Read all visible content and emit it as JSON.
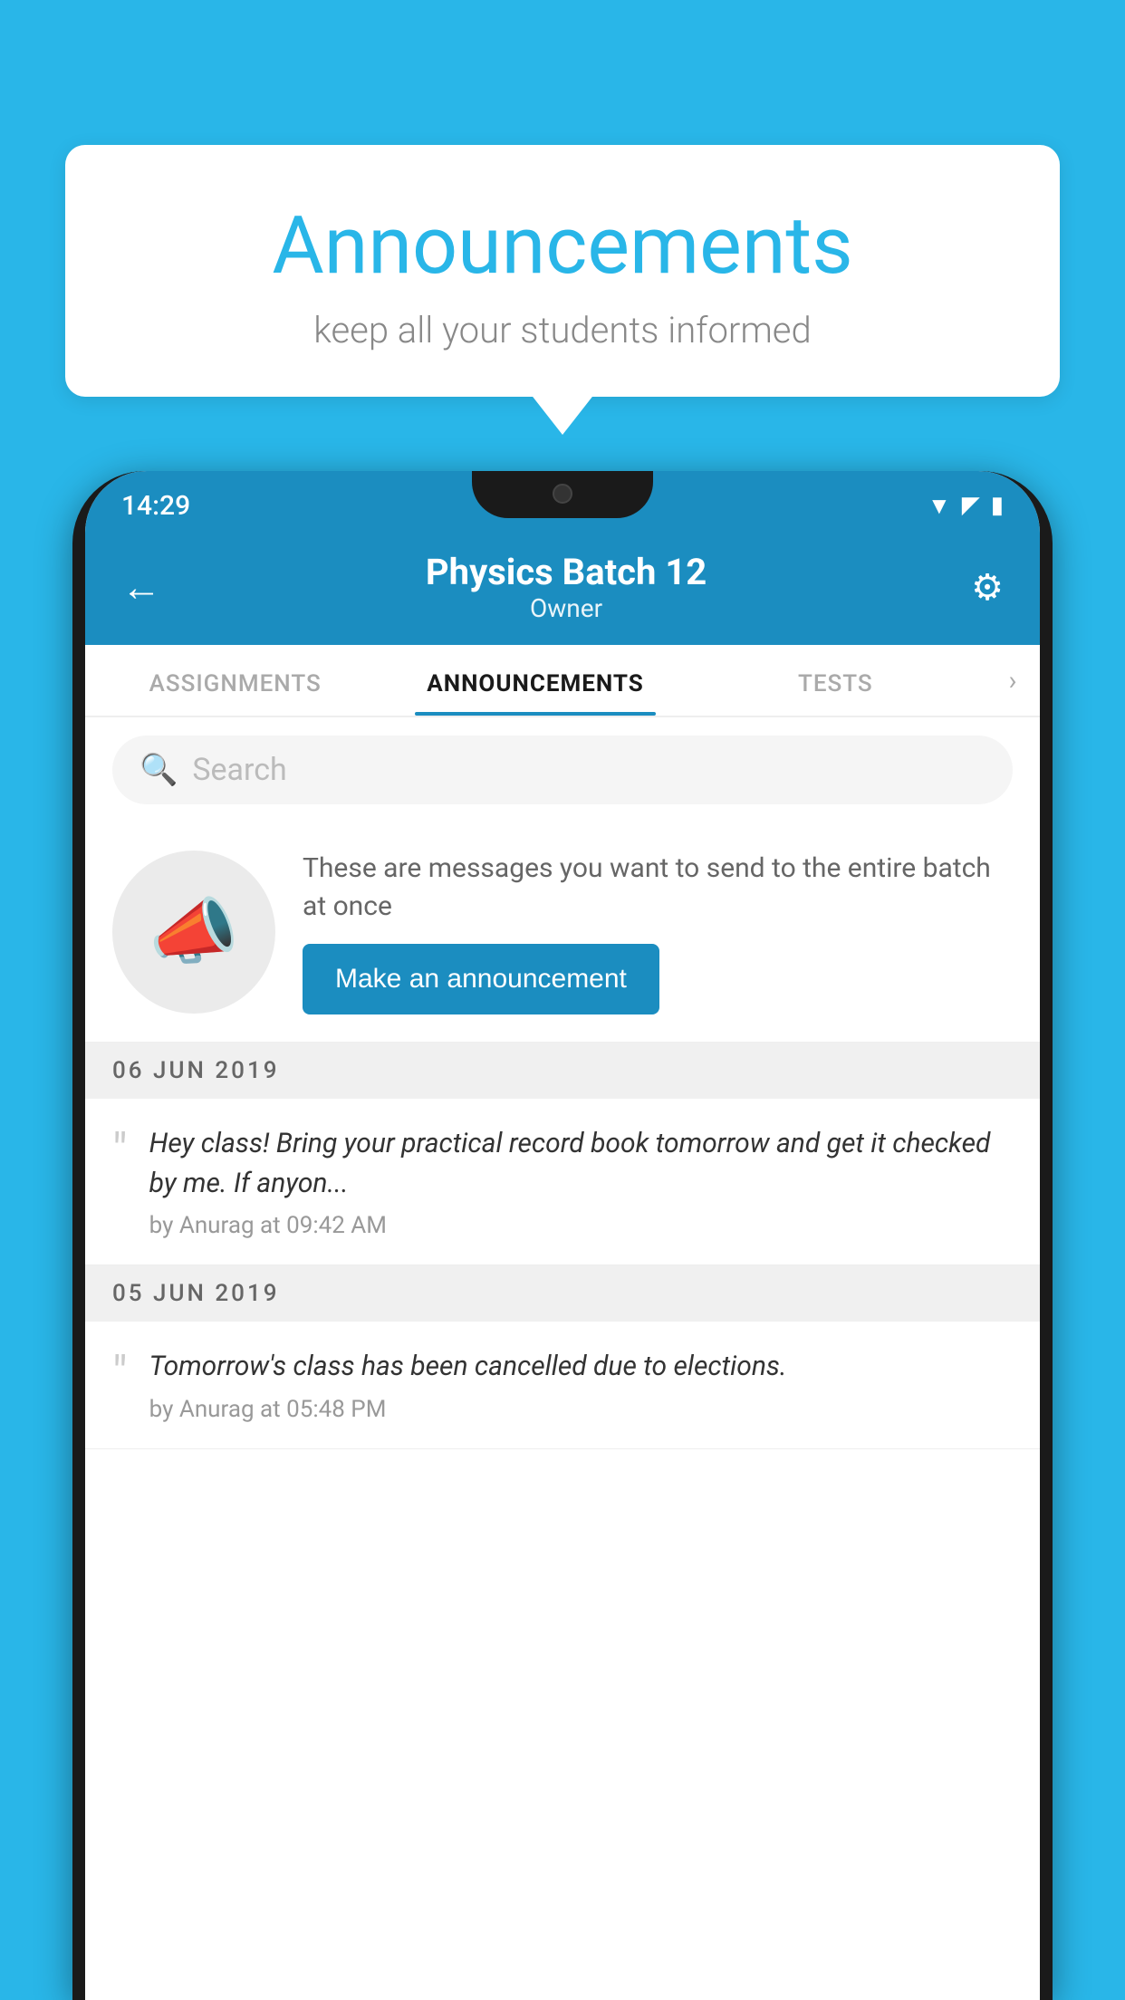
{
  "background": {
    "color": "#29B6E8"
  },
  "speech_bubble": {
    "title": "Announcements",
    "subtitle": "keep all your students informed"
  },
  "phone": {
    "status_bar": {
      "time": "14:29"
    },
    "header": {
      "title": "Physics Batch 12",
      "subtitle": "Owner",
      "back_icon": "←",
      "settings_icon": "⚙"
    },
    "tabs": [
      {
        "label": "ASSIGNMENTS",
        "active": false
      },
      {
        "label": "ANNOUNCEMENTS",
        "active": true
      },
      {
        "label": "TESTS",
        "active": false
      }
    ],
    "search": {
      "placeholder": "Search"
    },
    "promo": {
      "description": "These are messages you want to send to the entire batch at once",
      "button_label": "Make an announcement"
    },
    "announcements": [
      {
        "date": "06  JUN  2019",
        "text": "Hey class! Bring your practical record book tomorrow and get it checked by me. If anyon...",
        "meta": "by Anurag at 09:42 AM"
      },
      {
        "date": "05  JUN  2019",
        "text": "Tomorrow's class has been cancelled due to elections.",
        "meta": "by Anurag at 05:48 PM"
      }
    ]
  }
}
